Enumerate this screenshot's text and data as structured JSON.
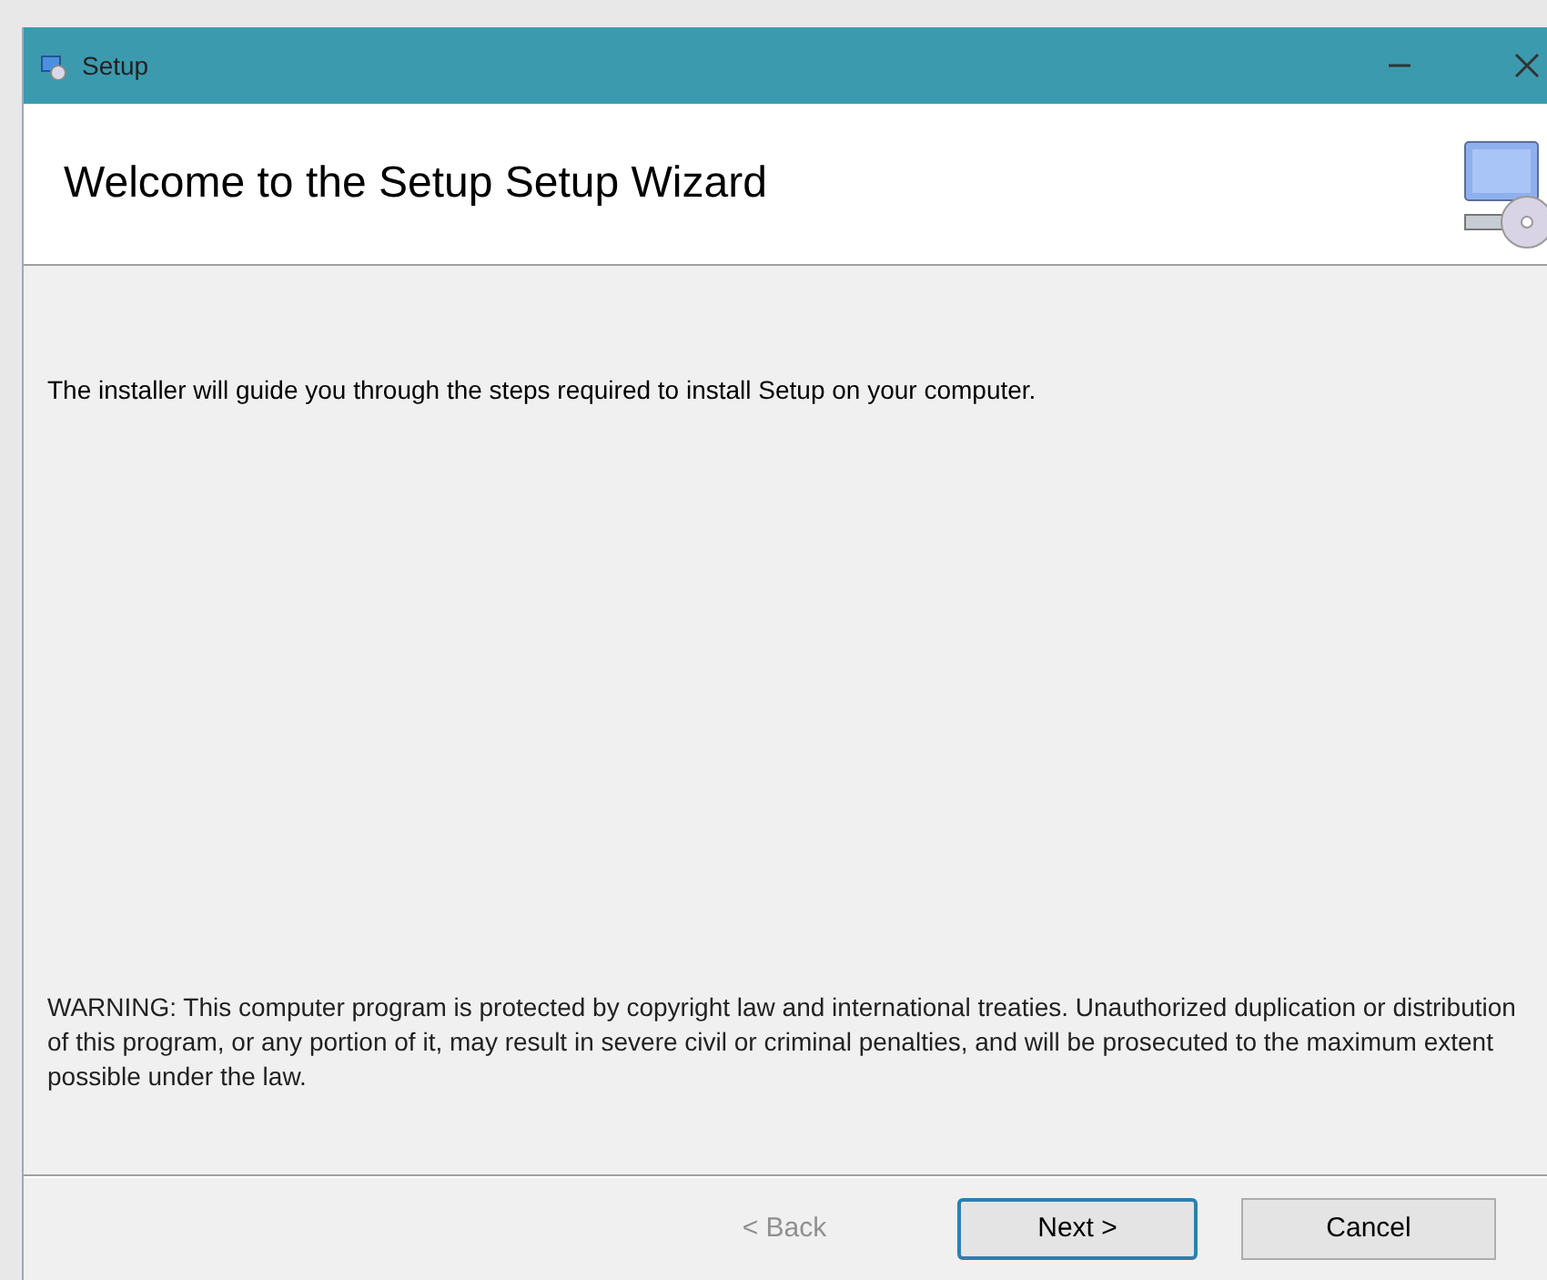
{
  "window": {
    "title": "Setup"
  },
  "header": {
    "title": "Welcome to the Setup Setup Wizard"
  },
  "body": {
    "intro": "The installer will guide you through the steps required to install Setup on your computer.",
    "warning": "WARNING: This computer program is protected by copyright law and international treaties. Unauthorized duplication or distribution of this program, or any portion of it, may result in severe civil or criminal penalties, and will be prosecuted to the maximum extent possible under the law."
  },
  "buttons": [
    {
      "label": "< Back",
      "disabled": true,
      "default": false
    },
    {
      "label": "Next >",
      "disabled": false,
      "default": true
    },
    {
      "label": "Cancel",
      "disabled": false,
      "default": false
    }
  ]
}
